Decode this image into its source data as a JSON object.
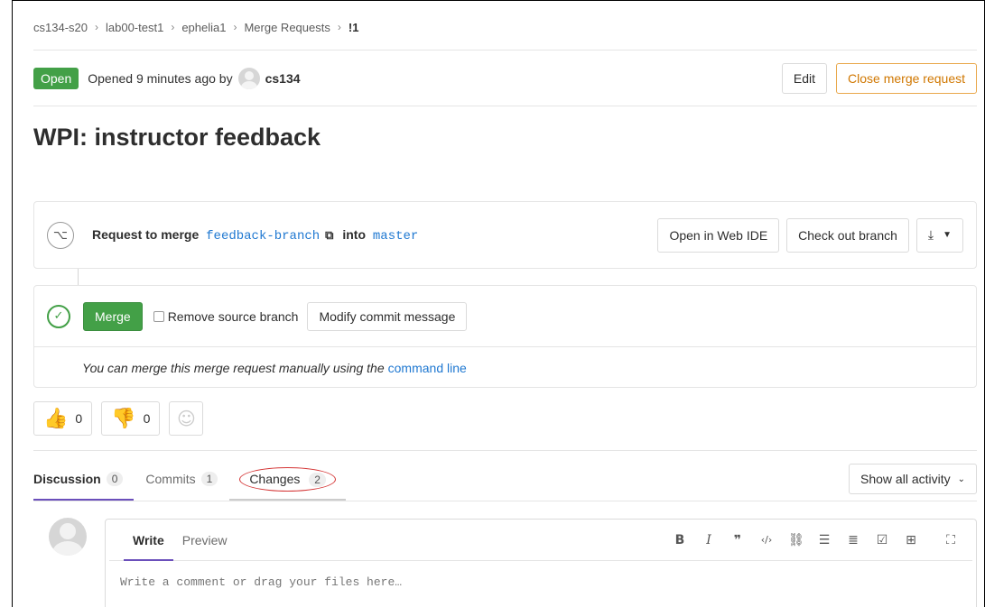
{
  "breadcrumb": [
    "cs134-s20",
    "lab00-test1",
    "ephelia1",
    "Merge Requests",
    "!1"
  ],
  "breadcrumb_sep": "›",
  "header": {
    "status": "Open",
    "opened_text": "Opened 9 minutes ago by",
    "author": "cs134",
    "edit_label": "Edit",
    "close_label": "Close merge request"
  },
  "title": "WPI: instructor feedback",
  "merge_info": {
    "request_to_merge": "Request to merge",
    "source_branch": "feedback-branch",
    "into": "into",
    "target_branch": "master",
    "web_ide_label": "Open in Web IDE",
    "checkout_label": "Check out branch"
  },
  "merge_box": {
    "merge_label": "Merge",
    "remove_source_label": "Remove source branch",
    "modify_commit_label": "Modify commit message",
    "manual_text": "You can merge this merge request manually using the",
    "command_line_link": "command line"
  },
  "awards": {
    "thumbs_up_count": "0",
    "thumbs_down_count": "0"
  },
  "tabs": [
    {
      "label": "Discussion",
      "count": "0"
    },
    {
      "label": "Commits",
      "count": "1"
    },
    {
      "label": "Changes",
      "count": "2"
    }
  ],
  "activity_label": "Show all activity",
  "comment": {
    "write_tab": "Write",
    "preview_tab": "Preview",
    "placeholder": "Write a comment or drag your files here…"
  },
  "icons": {
    "merge_request": "merge-request-icon",
    "copy": "copy-icon",
    "download": "download-icon",
    "check_circle": "check-circle-icon",
    "thumbs_up": "thumbs-up-icon",
    "thumbs_down": "thumbs-down-icon",
    "smiley": "smiley-icon"
  },
  "colors": {
    "success": "#43a047",
    "warning": "#d07700",
    "link": "#1f78d1",
    "active_tab": "#6b4fbb",
    "annotation": "#d43434"
  }
}
